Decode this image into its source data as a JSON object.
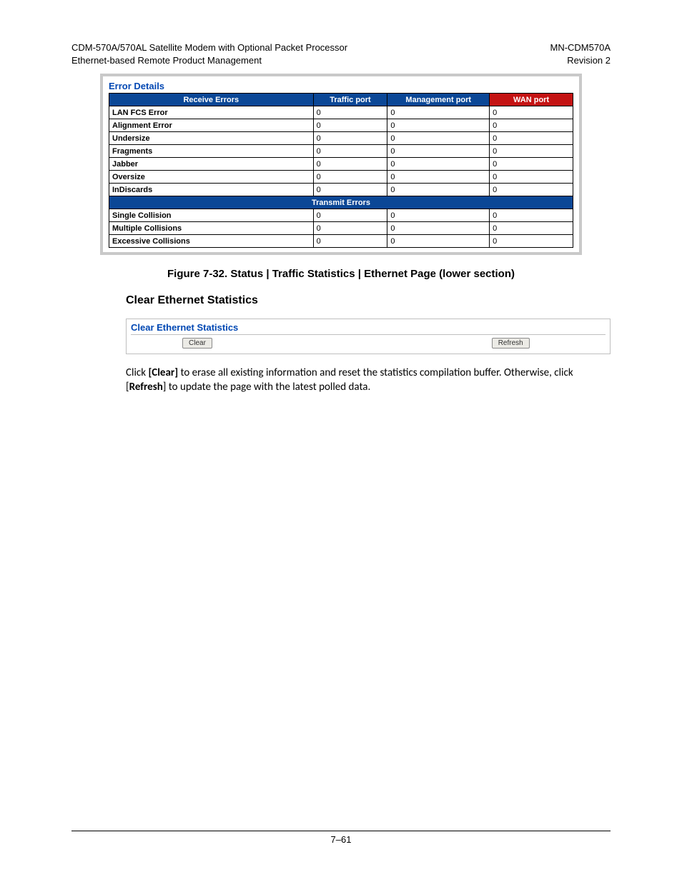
{
  "header": {
    "left_line1": "CDM-570A/570AL Satellite Modem with Optional Packet Processor",
    "left_line2": "Ethernet-based Remote Product Management",
    "right_line1": "MN-CDM570A",
    "right_line2": "Revision 2"
  },
  "error_panel": {
    "title": "Error Details",
    "cols": {
      "receive": "Receive Errors",
      "traffic": "Traffic port",
      "mgmt": "Management port",
      "wan": "WAN port"
    },
    "receive_rows": [
      {
        "label": "LAN FCS Error",
        "tp": "0",
        "mp": "0",
        "wp": "0"
      },
      {
        "label": "Alignment Error",
        "tp": "0",
        "mp": "0",
        "wp": "0"
      },
      {
        "label": "Undersize",
        "tp": "0",
        "mp": "0",
        "wp": "0"
      },
      {
        "label": "Fragments",
        "tp": "0",
        "mp": "0",
        "wp": "0"
      },
      {
        "label": "Jabber",
        "tp": "0",
        "mp": "0",
        "wp": "0"
      },
      {
        "label": "Oversize",
        "tp": "0",
        "mp": "0",
        "wp": "0"
      },
      {
        "label": "InDiscards",
        "tp": "0",
        "mp": "0",
        "wp": "0"
      }
    ],
    "transmit_header": "Transmit Errors",
    "transmit_rows": [
      {
        "label": "Single Collision",
        "tp": "0",
        "mp": "0",
        "wp": "0"
      },
      {
        "label": "Multiple Collisions",
        "tp": "0",
        "mp": "0",
        "wp": "0"
      },
      {
        "label": "Excessive Collisions",
        "tp": "0",
        "mp": "0",
        "wp": "0"
      }
    ]
  },
  "figure_caption": "Figure 7-32. Status | Traffic Statistics | Ethernet Page (lower section)",
  "section_heading": "Clear Ethernet Statistics",
  "clear_panel": {
    "title": "Clear Ethernet Statistics",
    "clear_btn": "Clear",
    "refresh_btn": "Refresh"
  },
  "body": {
    "pre_clear": "Click ",
    "clear_bold": "[Clear]",
    "post_clear": " to erase all existing information and reset the statistics compilation buffer. Otherwise, click [",
    "refresh_bold": "Refresh",
    "post_refresh": "] to update the page with the latest polled data."
  },
  "page_number": "7–61"
}
